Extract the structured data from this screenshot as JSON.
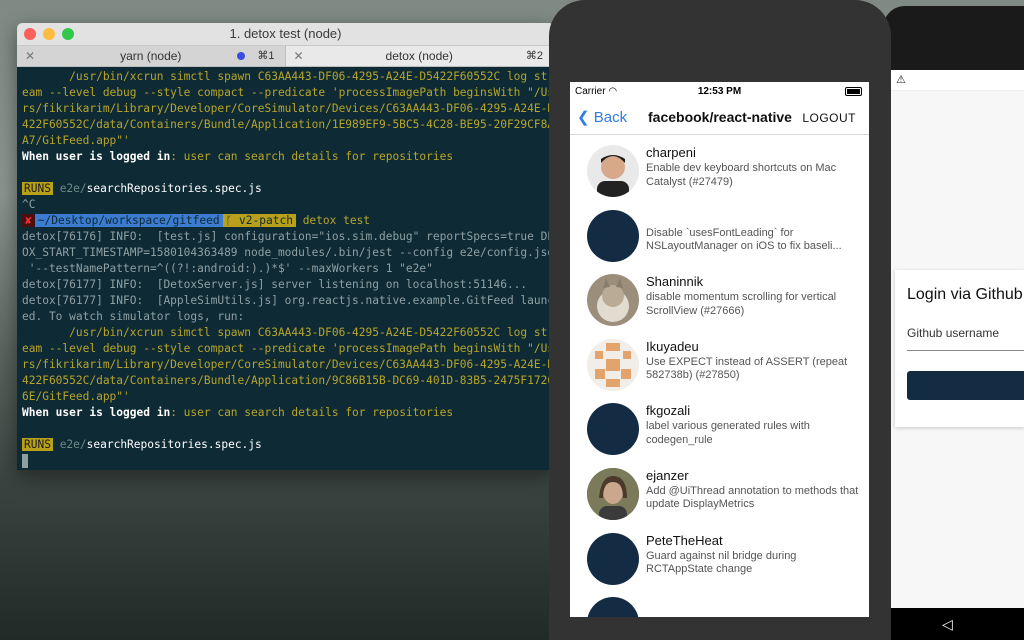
{
  "terminal": {
    "title": "1. detox test (node)",
    "tabs": [
      {
        "label": "yarn (node)",
        "shortcut": "⌘1",
        "close": "✕"
      },
      {
        "label": "detox (node)",
        "shortcut": "⌘2",
        "close": "✕"
      }
    ],
    "lines": {
      "l1": "       /usr/bin/xcrun simctl spawn C63AA443-DF06-4295-A24E-D5422F60552C log str",
      "l2": "eam --level debug --style compact --predicate 'processImagePath beginsWith \"/Use",
      "l3": "rs/fikrikarim/Library/Developer/CoreSimulator/Devices/C63AA443-DF06-4295-A24E-D5",
      "l4": "422F60552C/data/Containers/Bundle/Application/1E989EF9-5BC5-4C28-BE95-20F29CF8A6",
      "l5": "A7/GitFeed.app\"'",
      "l6a": "When user is logged in",
      "l6b": ": user can search details for repositories",
      "runs": "RUNS",
      "runs_dir": " e2e/",
      "runs_file": "searchRepositories.spec.js",
      "ctrlc": "^C",
      "prompt_x": "✘",
      "prompt_path": "~/Desktop/workspace/gitfeed",
      "prompt_branch": "ᚴ v2-patch",
      "prompt_cmd": " detox test",
      "d1": "detox[76176] INFO:  [test.js] configuration=\"ios.sim.debug\" reportSpecs=true DET",
      "d2": "OX_START_TIMESTAMP=1580104363489 node_modules/.bin/jest --config e2e/config.json",
      "d3": " '--testNamePattern=^((?!:android:).)*$' --maxWorkers 1 \"e2e\"",
      "d4": "detox[76177] INFO:  [DetoxServer.js] server listening on localhost:51146...",
      "d5": "detox[76177] INFO:  [AppleSimUtils.js] org.reactjs.native.example.GitFeed launch",
      "d6": "ed. To watch simulator logs, run:",
      "m1": "       /usr/bin/xcrun simctl spawn C63AA443-DF06-4295-A24E-D5422F60552C log str",
      "m2": "eam --level debug --style compact --predicate 'processImagePath beginsWith \"/Use",
      "m3": "rs/fikrikarim/Library/Developer/CoreSimulator/Devices/C63AA443-DF06-4295-A24E-D5",
      "m4": "422F60552C/data/Containers/Bundle/Application/9C86B15B-DC69-401D-83B5-2475F17267",
      "m5": "6E/GitFeed.app\"'"
    }
  },
  "iphone": {
    "carrier": "Carrier",
    "time": "12:53 PM",
    "back": "Back",
    "title": "facebook/react-native",
    "logout": "LOGOUT",
    "items": [
      {
        "name": "charpeni",
        "desc": "Enable dev keyboard shortcuts on Mac Catalyst (#27479)"
      },
      {
        "name": "",
        "desc": "Disable `usesFontLeading` for NSLayoutManager on iOS to fix baseli..."
      },
      {
        "name": "Shaninnik",
        "desc": "disable momentum scrolling for vertical ScrollView (#27666)"
      },
      {
        "name": "Ikuyadeu",
        "desc": "Use EXPECT instead of ASSERT (repeat 582738b) (#27850)"
      },
      {
        "name": "fkgozali",
        "desc": "label various generated rules with codegen_rule"
      },
      {
        "name": "ejanzer",
        "desc": "Add @UiThread annotation to methods that update DisplayMetrics"
      },
      {
        "name": "PeteTheHeat",
        "desc": "Guard against nil bridge during RCTAppState change"
      }
    ]
  },
  "android": {
    "warning": "⚠",
    "login_title": "Login via Github",
    "username_label": "Github username",
    "nav_back": "◁"
  },
  "colors": {
    "terminal_bg": "#0e2a35",
    "link_blue": "#2f7de1",
    "avatar_navy": "#132c44"
  }
}
